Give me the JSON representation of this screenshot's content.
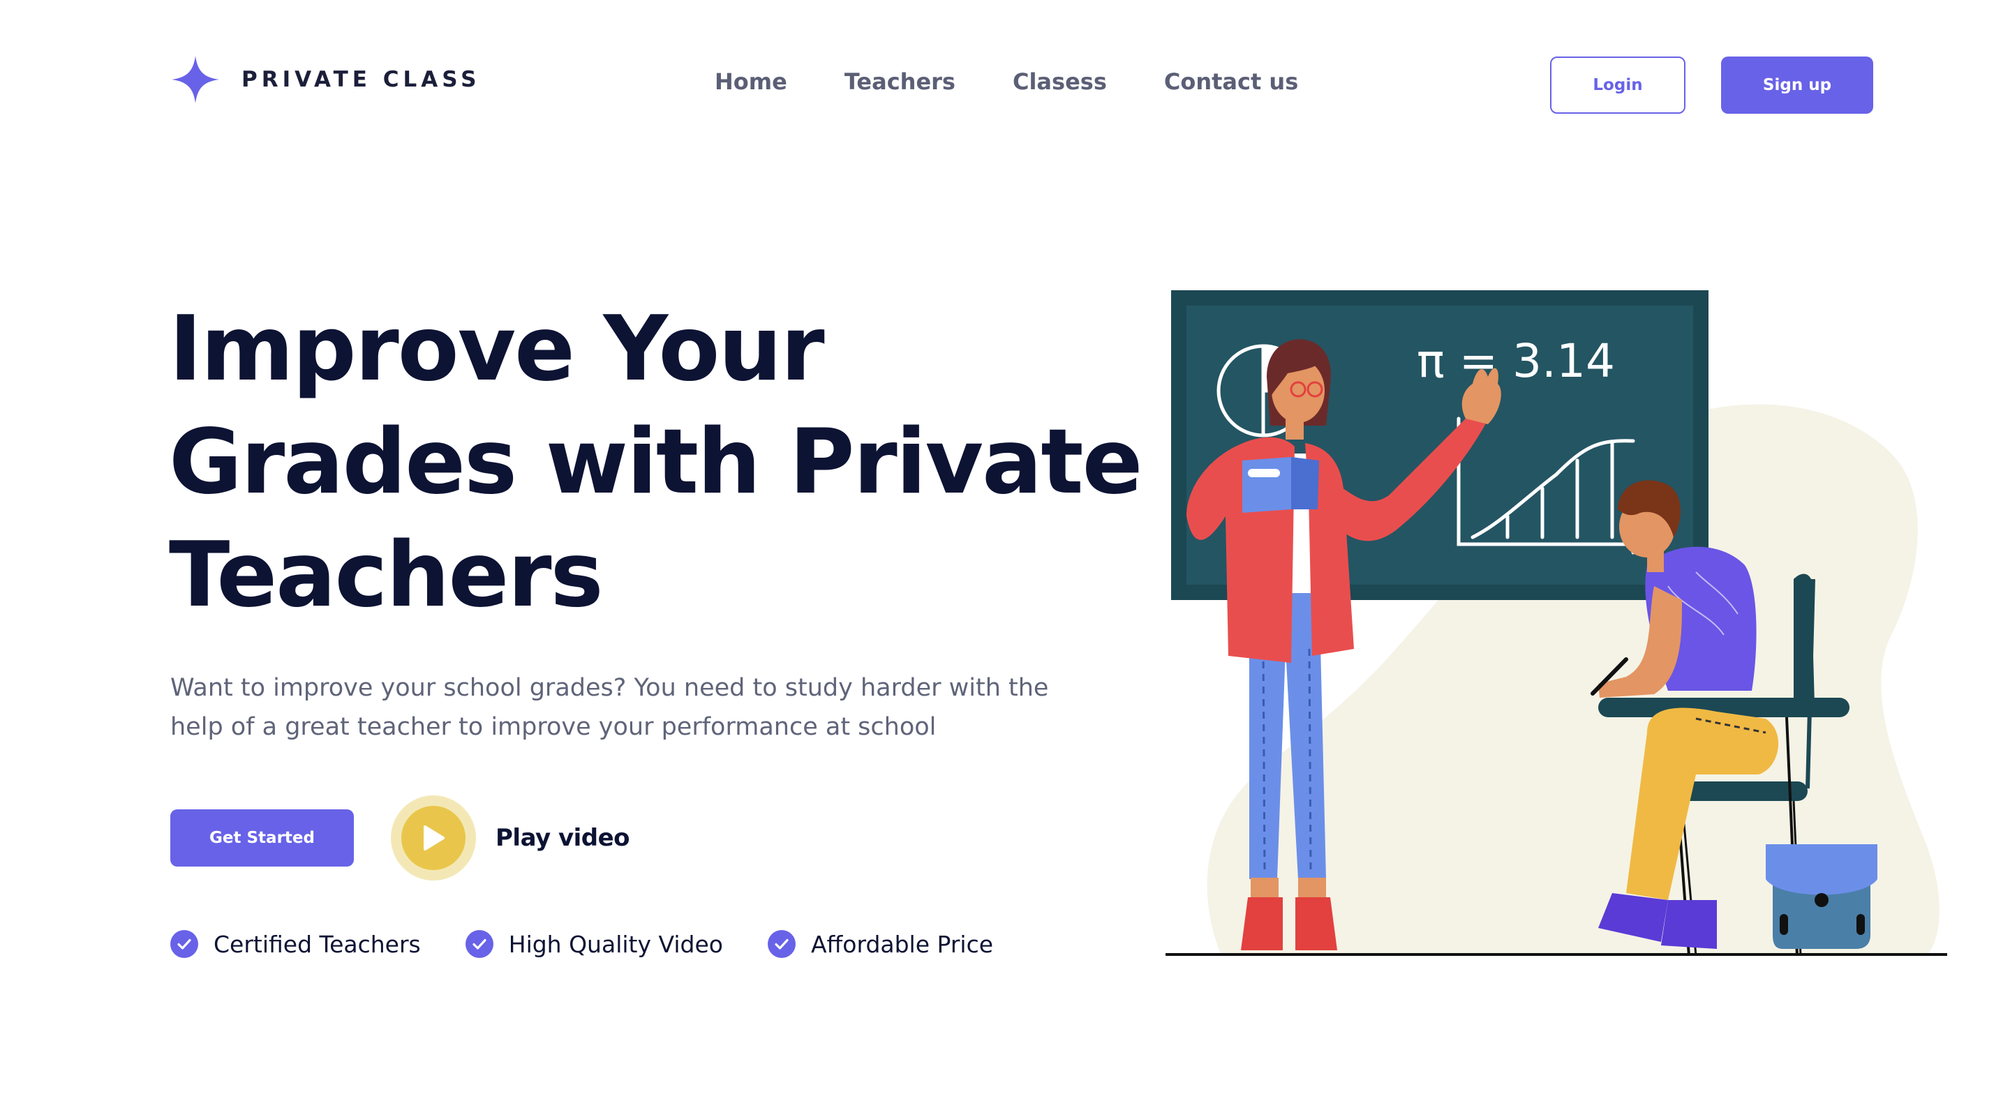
{
  "header": {
    "brand_name": "PRIVATE CLASS",
    "nav": [
      {
        "label": "Home"
      },
      {
        "label": "Teachers"
      },
      {
        "label": "Clasess"
      },
      {
        "label": "Contact us"
      }
    ],
    "login_label": "Login",
    "signup_label": "Sign up"
  },
  "hero": {
    "title": "Improve Your Grades with Private Teachers",
    "subtitle": "Want to improve your school grades? You need to study harder with the help of a great teacher to improve your performance at school",
    "get_started_label": "Get Started",
    "play_label": "Play video",
    "features": [
      {
        "label": "Certified Teachers",
        "icon": "check-circle-icon"
      },
      {
        "label": "High Quality Video",
        "icon": "check-circle-icon"
      },
      {
        "label": "Affordable Price",
        "icon": "check-circle-icon"
      }
    ]
  },
  "illustration": {
    "board_text": "π = 3.14"
  },
  "colors": {
    "accent": "#6862e8",
    "heading": "#0d1333",
    "body_text": "#5f6479",
    "nav_text": "#5b5f76",
    "play_yellow": "#e9c64b",
    "board": "#234f5c"
  }
}
